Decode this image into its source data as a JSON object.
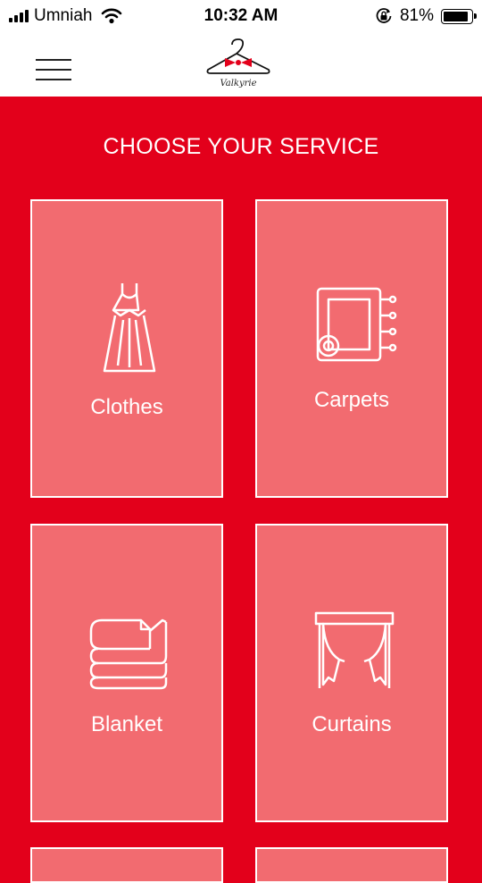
{
  "status_bar": {
    "carrier": "Umniah",
    "time": "10:32 AM",
    "battery_percent": "81%",
    "battery_level": 0.81,
    "icons": [
      "signal-icon",
      "wifi-icon",
      "orientation-lock-icon",
      "battery-icon"
    ]
  },
  "header": {
    "menu_icon": "hamburger-menu-icon",
    "logo_text": "Valkyrie"
  },
  "main": {
    "title": "CHOOSE YOUR SERVICE",
    "services": [
      {
        "label": "Clothes",
        "icon": "dress-icon"
      },
      {
        "label": "Carpets",
        "icon": "carpet-icon"
      },
      {
        "label": "Blanket",
        "icon": "blanket-icon"
      },
      {
        "label": "Curtains",
        "icon": "curtains-icon"
      }
    ]
  },
  "colors": {
    "background": "#e3001b",
    "card": "#f26b70",
    "text": "#ffffff",
    "bow_tie": "#e3001b"
  }
}
